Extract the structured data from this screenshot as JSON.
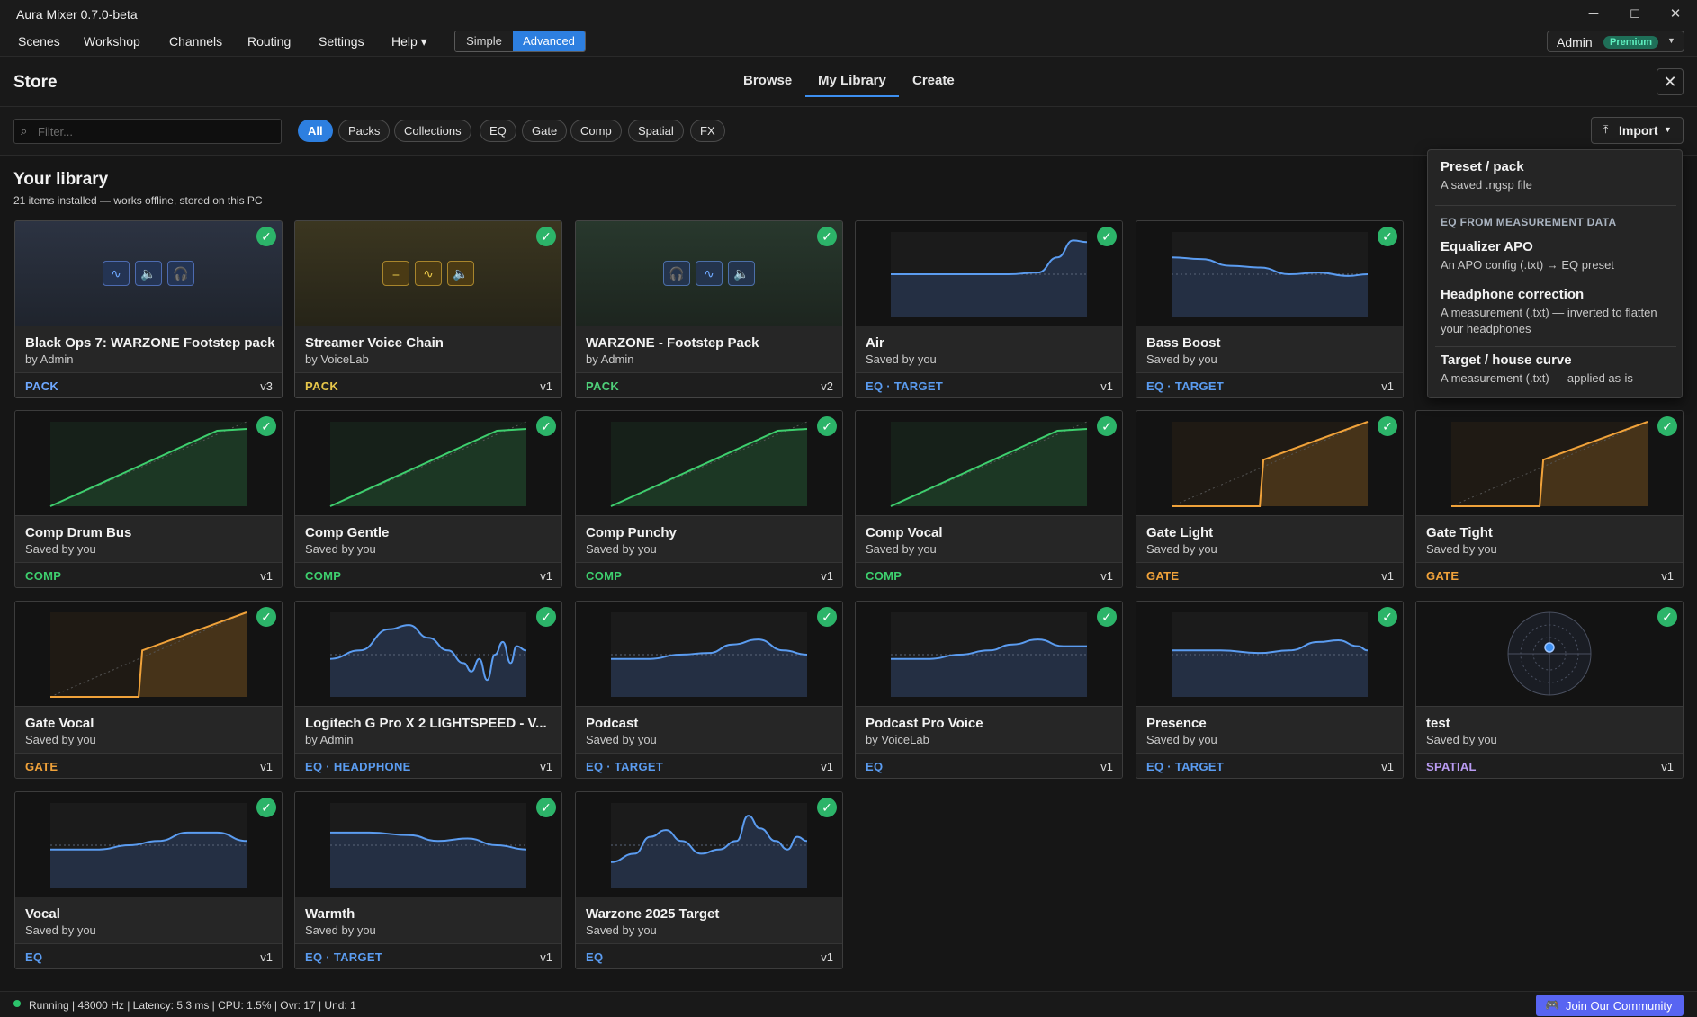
{
  "window": {
    "title": "Aura Mixer 0.7.0-beta",
    "minimize": "─",
    "maximize": "☐",
    "close": "✕"
  },
  "menu": {
    "items": [
      "Scenes",
      "Workshop",
      "Channels",
      "Routing",
      "Settings",
      "Help ▾"
    ],
    "mode_simple": "Simple",
    "mode_advanced": "Advanced",
    "mode_selected": "Advanced",
    "user": "Admin",
    "badge": "Premium"
  },
  "store": {
    "title": "Store",
    "tabs": [
      "Browse",
      "My Library",
      "Create"
    ],
    "active_tab": "My Library",
    "close": "✕"
  },
  "filter": {
    "placeholder": "Filter...",
    "value": "",
    "chips": [
      "All",
      "Packs",
      "Collections",
      "EQ",
      "Gate",
      "Comp",
      "Spatial",
      "FX"
    ],
    "active_chip": "All",
    "import_label": "Import"
  },
  "library": {
    "title": "Your library",
    "subtitle": "21 items installed — works offline, stored on this PC",
    "items": [
      {
        "name": "Black Ops 7: WARZONE Footstep pack",
        "by": "by Admin",
        "type": "PACK",
        "version": "v3",
        "thumb": "pack",
        "icons": [
          "pulse-icon",
          "speaker-icon",
          "headphones-icon"
        ],
        "theme": "blue"
      },
      {
        "name": "Streamer Voice Chain",
        "by": "by VoiceLab",
        "type": "PACK",
        "version": "v1",
        "thumb": "pack",
        "icons": [
          "equals-icon",
          "pulse-icon",
          "speaker-icon"
        ],
        "theme": "yellow"
      },
      {
        "name": "WARZONE - Footstep Pack",
        "by": "by Admin",
        "type": "PACK",
        "version": "v2",
        "thumb": "pack",
        "icons": [
          "headphones-icon",
          "pulse-icon",
          "speaker-icon"
        ],
        "theme": "green"
      },
      {
        "name": "Air",
        "by": "Saved by you",
        "type": "EQ · TARGET",
        "version": "v1",
        "thumb": "eq",
        "curve": "air"
      },
      {
        "name": "Bass Boost",
        "by": "Saved by you",
        "type": "EQ · TARGET",
        "version": "v1",
        "thumb": "eq",
        "curve": "bass"
      },
      {
        "name": "",
        "by": "",
        "type": "",
        "version": "",
        "thumb": "hidden"
      },
      {
        "name": "Comp Drum Bus",
        "by": "Saved by you",
        "type": "COMP",
        "version": "v1",
        "thumb": "comp"
      },
      {
        "name": "Comp Gentle",
        "by": "Saved by you",
        "type": "COMP",
        "version": "v1",
        "thumb": "comp"
      },
      {
        "name": "Comp Punchy",
        "by": "Saved by you",
        "type": "COMP",
        "version": "v1",
        "thumb": "comp"
      },
      {
        "name": "Comp Vocal",
        "by": "Saved by you",
        "type": "COMP",
        "version": "v1",
        "thumb": "comp"
      },
      {
        "name": "Gate Light",
        "by": "Saved by you",
        "type": "GATE",
        "version": "v1",
        "thumb": "gate"
      },
      {
        "name": "Gate Tight",
        "by": "Saved by you",
        "type": "GATE",
        "version": "v1",
        "thumb": "gate"
      },
      {
        "name": "Gate Vocal",
        "by": "Saved by you",
        "type": "GATE",
        "version": "v1",
        "thumb": "gate"
      },
      {
        "name": "Logitech G Pro X 2 LIGHTSPEED - V...",
        "by": "by Admin",
        "type": "EQ · HEADPHONE",
        "version": "v1",
        "thumb": "eq",
        "curve": "headphone"
      },
      {
        "name": "Podcast",
        "by": "Saved by you",
        "type": "EQ · TARGET",
        "version": "v1",
        "thumb": "eq",
        "curve": "podcast"
      },
      {
        "name": "Podcast Pro Voice",
        "by": "by VoiceLab",
        "type": "EQ",
        "version": "v1",
        "thumb": "eq",
        "curve": "podcastpro"
      },
      {
        "name": "Presence",
        "by": "Saved by you",
        "type": "EQ · TARGET",
        "version": "v1",
        "thumb": "eq",
        "curve": "presence"
      },
      {
        "name": "test",
        "by": "Saved by you",
        "type": "SPATIAL",
        "version": "v1",
        "thumb": "spatial"
      },
      {
        "name": "Vocal",
        "by": "Saved by you",
        "type": "EQ",
        "version": "v1",
        "thumb": "eq",
        "curve": "vocal"
      },
      {
        "name": "Warmth",
        "by": "Saved by you",
        "type": "EQ · TARGET",
        "version": "v1",
        "thumb": "eq",
        "curve": "warmth"
      },
      {
        "name": "Warzone 2025 Target",
        "by": "Saved by you",
        "type": "EQ",
        "version": "v1",
        "thumb": "eq",
        "curve": "warzone"
      }
    ]
  },
  "import_menu": {
    "pack_title": "Preset / pack",
    "pack_desc": "A saved .ngsp file",
    "section": "EQ FROM MEASUREMENT DATA",
    "apo_title": "Equalizer APO",
    "apo_desc": "An APO config (.txt) → EQ preset",
    "hp_title": "Headphone correction",
    "hp_desc": "A measurement (.txt) — inverted to flatten your headphones",
    "target_title": "Target / house curve",
    "target_desc": "A measurement (.txt) — applied as-is"
  },
  "status": {
    "text": "Running | 48000 Hz | Latency: 5.3 ms | CPU: 1.5% | Ovr: 17 | Und: 1",
    "community": "Join Our Community"
  },
  "colors": {
    "accent": "#2d7fe0",
    "pack_blue": "#6ea8ff",
    "pack_yellow": "#e6c64a",
    "pack_green": "#4fd07a",
    "eq": "#5b9cf0",
    "comp": "#3ecf6e",
    "gate": "#f0a23a",
    "spatial": "#b99bf2",
    "installed": "#2cb469"
  }
}
